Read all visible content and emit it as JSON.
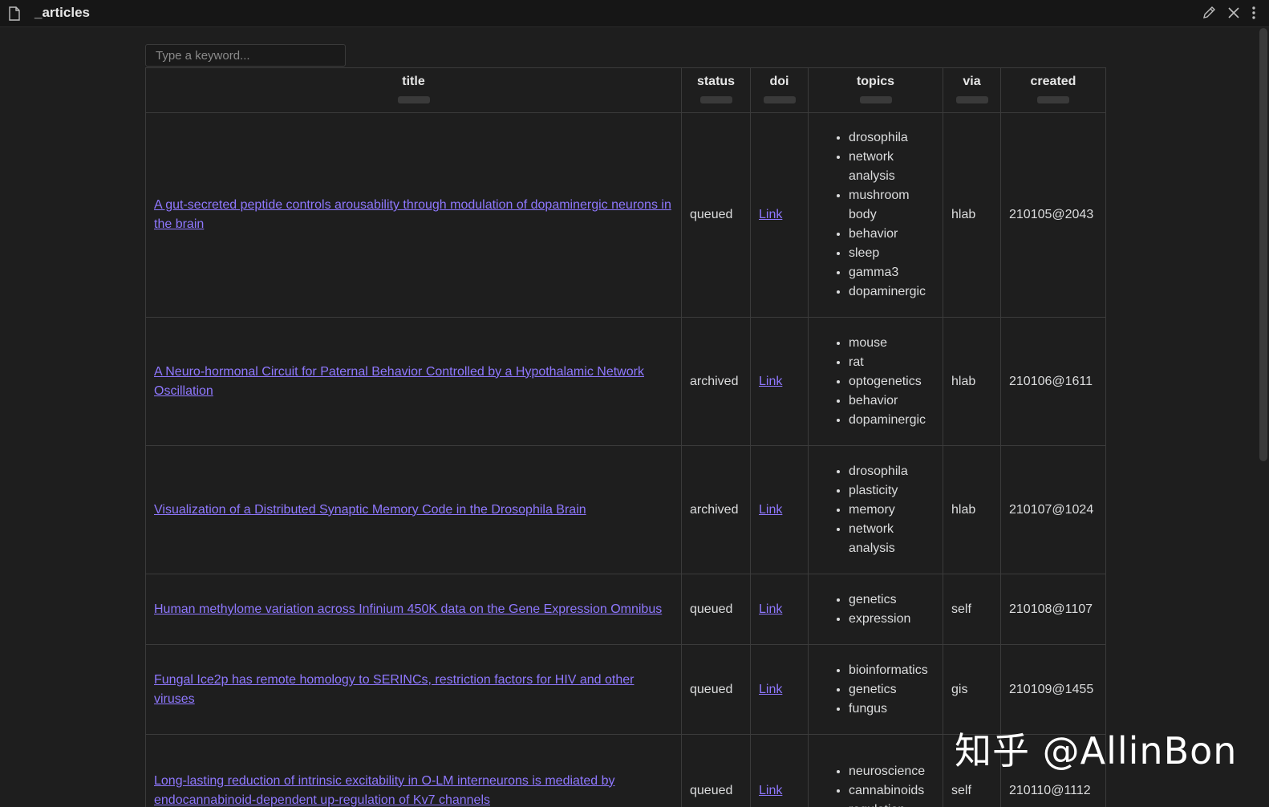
{
  "window": {
    "title": "_articles",
    "icons": [
      "file-icon",
      "edit-icon",
      "close-icon",
      "more-options-icon"
    ]
  },
  "search": {
    "placeholder": "Type a keyword..."
  },
  "table": {
    "columns": [
      "title",
      "status",
      "doi",
      "topics",
      "via",
      "created"
    ],
    "rows": [
      {
        "title": "A gut-secreted peptide controls arousability through modulation of dopaminergic neurons in the brain",
        "status": "queued",
        "doi": "Link",
        "topics": [
          "drosophila",
          "network analysis",
          "mushroom body",
          "behavior",
          "sleep",
          "gamma3",
          "dopaminergic"
        ],
        "via": "hlab",
        "created": "210105@2043"
      },
      {
        "title": "A Neuro-hormonal Circuit for Paternal Behavior Controlled by a Hypothalamic Network Oscillation",
        "status": "archived",
        "doi": "Link",
        "topics": [
          "mouse",
          "rat",
          "optogenetics",
          "behavior",
          "dopaminergic"
        ],
        "via": "hlab",
        "created": "210106@1611"
      },
      {
        "title": "Visualization of a Distributed Synaptic Memory Code in the Drosophila Brain",
        "status": "archived",
        "doi": "Link",
        "topics": [
          "drosophila",
          "plasticity",
          "memory",
          "network analysis"
        ],
        "via": "hlab",
        "created": "210107@1024"
      },
      {
        "title": "Human methylome variation across Infinium 450K data on the Gene Expression Omnibus",
        "status": "queued",
        "doi": "Link",
        "topics": [
          "genetics",
          "expression"
        ],
        "via": "self",
        "created": "210108@1107"
      },
      {
        "title": "Fungal Ice2p has remote homology to SERINCs, restriction factors for HIV and other viruses",
        "status": "queued",
        "doi": "Link",
        "topics": [
          "bioinformatics",
          "genetics",
          "fungus"
        ],
        "via": "gis",
        "created": "210109@1455"
      },
      {
        "title": "Long-lasting reduction of intrinsic excitability in O-LM interneurons is mediated by endocannabinoid-dependent up-regulation of Kv7 channels",
        "status": "queued",
        "doi": "Link",
        "topics": [
          "neuroscience",
          "cannabinoids",
          "regulation"
        ],
        "via": "self",
        "created": "210110@1112"
      }
    ]
  },
  "watermark": "知乎 @AllinBon",
  "colors": {
    "background": "#1e1e1e",
    "link": "#8f78ff",
    "border": "#3b3b3b"
  }
}
